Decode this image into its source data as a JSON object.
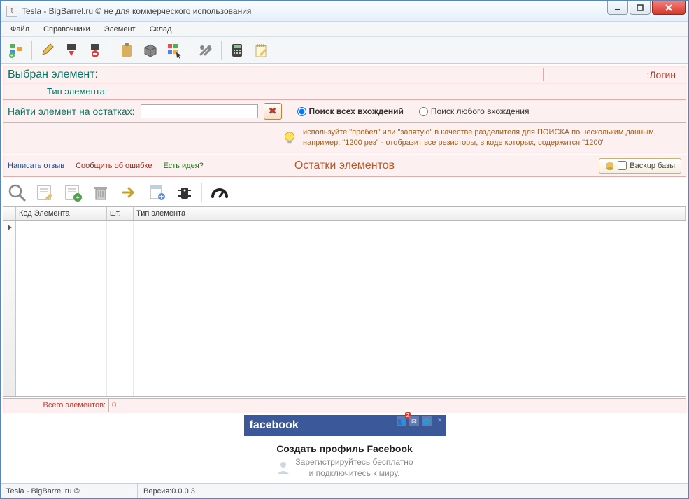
{
  "window": {
    "title": "Tesla - BigBarrel.ru © не для коммерческого использования"
  },
  "menu": {
    "file": "Файл",
    "refs": "Справочники",
    "element": "Элемент",
    "stock": "Склад"
  },
  "selected": {
    "label": "Выбран элемент:",
    "login": ":Логин",
    "type_label": "Тип элемента:"
  },
  "search": {
    "label": "Найти элемент на остатках:",
    "value": "",
    "radio_all": "Поиск всех вхождений",
    "radio_any": "Поиск любого вхождения",
    "hint": "используйте \"пробел\" или \"запятую\" в качестве разделителя для ПОИСКА по нескольким данным, например: \"1200 рез\" - отобразит все резисторы, в коде которых, содержится \"1200\""
  },
  "links": {
    "review": "Написать отзыв",
    "bug": "Сообщить об ошибке",
    "idea": "Есть идея?",
    "title": "Остатки элементов",
    "backup": "Backup базы"
  },
  "grid": {
    "col_code": "Код Элемента",
    "col_qty": "шт.",
    "col_type": "Тип элемента"
  },
  "footer": {
    "total_label": "Всего элементов:",
    "total_value": "0"
  },
  "ad": {
    "brand": "facebook",
    "title": "Создать профиль Facebook",
    "sub1": "Зарегистрируйтесь бесплатно",
    "sub2": "и подключитесь к миру.",
    "badge1": "2"
  },
  "status": {
    "left": "Tesla - BigBarrel.ru ©",
    "version": "Версия:0.0.0.3"
  }
}
